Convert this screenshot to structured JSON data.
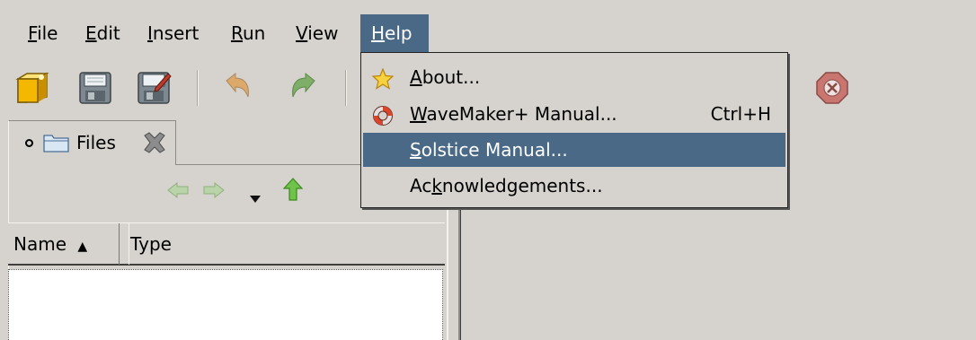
{
  "menubar": {
    "items": [
      {
        "label": "File",
        "mnemonic": "F",
        "rest": "ile"
      },
      {
        "label": "Edit",
        "mnemonic": "E",
        "rest": "dit"
      },
      {
        "label": "Insert",
        "mnemonic": "I",
        "rest": "nsert"
      },
      {
        "label": "Run",
        "mnemonic": "R",
        "rest": "un"
      },
      {
        "label": "View",
        "mnemonic": "V",
        "rest": "iew"
      },
      {
        "label": "Help",
        "mnemonic": "H",
        "rest": "elp"
      }
    ],
    "active": "Help"
  },
  "toolbar": {
    "icons": [
      "new-project-icon",
      "save-icon",
      "save-as-icon",
      "undo-icon",
      "redo-icon",
      "stop-icon"
    ]
  },
  "files_pane": {
    "tab_label": "Files",
    "columns": [
      {
        "label": "Name",
        "sort": "▲"
      },
      {
        "label": "Type"
      }
    ]
  },
  "help_menu": {
    "items": [
      {
        "before": "",
        "mnemonic": "A",
        "after": "bout...",
        "shortcut": "",
        "icon": "star-icon"
      },
      {
        "before": "",
        "mnemonic": "W",
        "after": "aveMaker+ Manual...",
        "shortcut": "Ctrl+H",
        "icon": "lifebuoy-icon"
      },
      {
        "before": "",
        "mnemonic": "S",
        "after": "olstice Manual...",
        "shortcut": "",
        "icon": ""
      },
      {
        "before": "Ac",
        "mnemonic": "k",
        "after": "nowledgements...",
        "shortcut": "",
        "icon": ""
      }
    ],
    "highlighted_index": 2
  },
  "colors": {
    "background": "#d6d3ce",
    "highlight": "#4a6986"
  }
}
